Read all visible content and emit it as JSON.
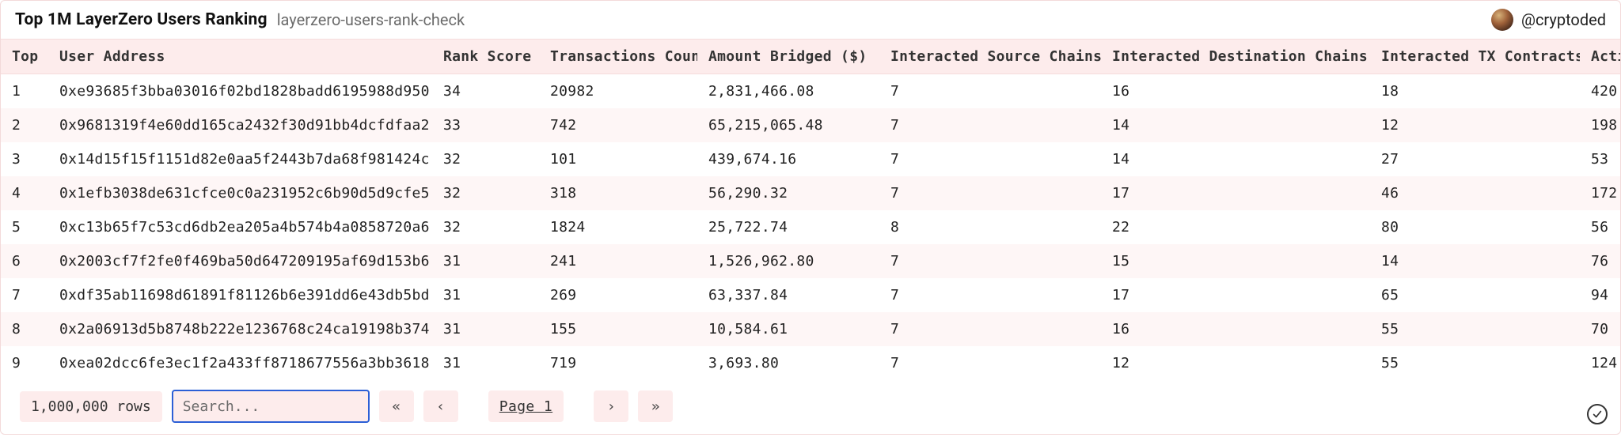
{
  "header": {
    "title": "Top 1M LayerZero Users Ranking",
    "slug": "layerzero-users-rank-check",
    "handle": "@cryptoded"
  },
  "columns": [
    "Top",
    "User Address",
    "Rank Score",
    "Transactions Count",
    "Amount Bridged ($)",
    "Interacted Source Chains",
    "Interacted Destination Chains",
    "Interacted TX Contracts",
    "Acti"
  ],
  "rows": [
    {
      "top": "1",
      "addr": "0xe93685f3bba03016f02bd1828badd6195988d950",
      "rank": "34",
      "tx": "20982",
      "amt": "2,831,466.08",
      "src": "7",
      "dst": "16",
      "ctr": "18",
      "act": "420"
    },
    {
      "top": "2",
      "addr": "0x9681319f4e60dd165ca2432f30d91bb4dcfdfaa2",
      "rank": "33",
      "tx": "742",
      "amt": "65,215,065.48",
      "src": "7",
      "dst": "14",
      "ctr": "12",
      "act": "198"
    },
    {
      "top": "3",
      "addr": "0x14d15f15f1151d82e0aa5f2443b7da68f981424c",
      "rank": "32",
      "tx": "101",
      "amt": "439,674.16",
      "src": "7",
      "dst": "14",
      "ctr": "27",
      "act": "53"
    },
    {
      "top": "4",
      "addr": "0x1efb3038de631cfce0c0a231952c6b90d5d9cfe5",
      "rank": "32",
      "tx": "318",
      "amt": "56,290.32",
      "src": "7",
      "dst": "17",
      "ctr": "46",
      "act": "172"
    },
    {
      "top": "5",
      "addr": "0xc13b65f7c53cd6db2ea205a4b574b4a0858720a6",
      "rank": "32",
      "tx": "1824",
      "amt": "25,722.74",
      "src": "8",
      "dst": "22",
      "ctr": "80",
      "act": "56"
    },
    {
      "top": "6",
      "addr": "0x2003cf7f2fe0f469ba50d647209195af69d153b6",
      "rank": "31",
      "tx": "241",
      "amt": "1,526,962.80",
      "src": "7",
      "dst": "15",
      "ctr": "14",
      "act": "76"
    },
    {
      "top": "7",
      "addr": "0xdf35ab11698d61891f81126b6e391dd6e43db5bd",
      "rank": "31",
      "tx": "269",
      "amt": "63,337.84",
      "src": "7",
      "dst": "17",
      "ctr": "65",
      "act": "94"
    },
    {
      "top": "8",
      "addr": "0x2a06913d5b8748b222e1236768c24ca19198b374",
      "rank": "31",
      "tx": "155",
      "amt": "10,584.61",
      "src": "7",
      "dst": "16",
      "ctr": "55",
      "act": "70"
    },
    {
      "top": "9",
      "addr": "0xea02dcc6fe3ec1f2a433ff8718677556a3bb3618",
      "rank": "31",
      "tx": "719",
      "amt": "3,693.80",
      "src": "7",
      "dst": "12",
      "ctr": "55",
      "act": "124"
    }
  ],
  "footer": {
    "rowcount": "1,000,000 rows",
    "search_placeholder": "Search...",
    "first_icon": "«",
    "prev_icon": "‹",
    "page_label": "Page 1",
    "next_icon": "›",
    "last_icon": "»"
  }
}
